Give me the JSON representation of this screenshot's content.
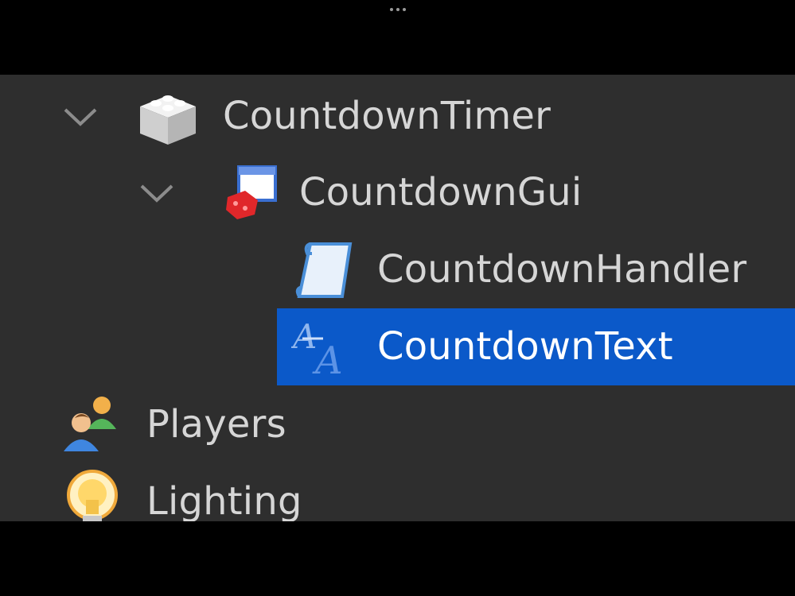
{
  "window": {
    "menu_icon": "more-dots-icon"
  },
  "explorer": {
    "items": [
      {
        "label": "CountdownTimer",
        "icon": "model-icon",
        "expanded": true,
        "depth": 0
      },
      {
        "label": "CountdownGui",
        "icon": "screen-gui-icon",
        "expanded": true,
        "depth": 1
      },
      {
        "label": "CountdownHandler",
        "icon": "script-icon",
        "depth": 2
      },
      {
        "label": "CountdownText",
        "icon": "text-label-icon",
        "depth": 2,
        "selected": true
      },
      {
        "label": "Players",
        "icon": "players-icon",
        "depth": -1
      },
      {
        "label": "Lighting",
        "icon": "lighting-icon",
        "depth": -1
      }
    ]
  },
  "colors": {
    "background": "#2e2e2e",
    "selection": "#0b59c9",
    "text": "#d6d6d6",
    "selected_text": "#ffffff"
  }
}
